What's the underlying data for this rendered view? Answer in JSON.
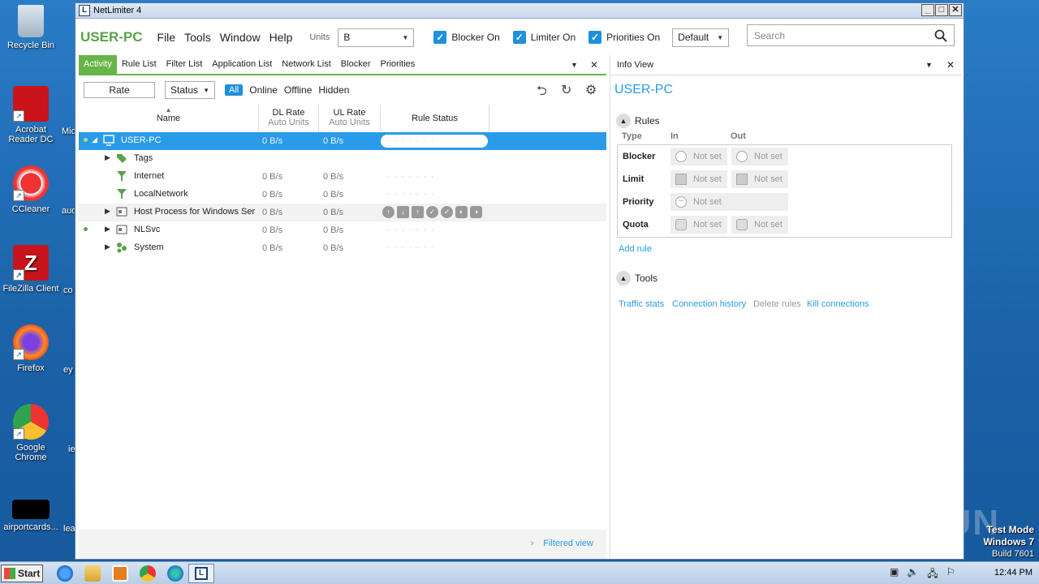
{
  "desktop": {
    "icons": [
      {
        "label": "Recycle Bin"
      },
      {
        "label": "Acrobat Reader DC"
      },
      {
        "label": "CCleaner"
      },
      {
        "label": "FileZilla Client"
      },
      {
        "label": "Firefox"
      },
      {
        "label": "Google Chrome"
      },
      {
        "label": "airportcards..."
      }
    ],
    "partial_labels": [
      "Mic",
      "aud",
      "co",
      "ey",
      "ie",
      "lea"
    ],
    "watermark": "ANY RUN",
    "testmode": {
      "line1": "Test Mode",
      "line2": "Windows 7",
      "line3": "Build 7601"
    }
  },
  "window": {
    "title": "NetLimiter 4",
    "brand": "USER-PC",
    "menu": [
      "File",
      "Tools",
      "Window",
      "Help"
    ],
    "units_label": "Units",
    "units_value": "B",
    "checkboxes": [
      {
        "label": "Blocker On",
        "checked": true
      },
      {
        "label": "Limiter On",
        "checked": true
      },
      {
        "label": "Priorities On",
        "checked": true
      }
    ],
    "profile": "Default",
    "search_placeholder": "Search"
  },
  "left": {
    "tabs": [
      "Activity",
      "Rule List",
      "Filter List",
      "Application List",
      "Network List",
      "Blocker",
      "Priorities"
    ],
    "rate_box": "Rate",
    "status_select": "Status",
    "filters": {
      "all": "All",
      "online": "Online",
      "offline": "Offline",
      "hidden": "Hidden"
    },
    "columns": {
      "name": "Name",
      "dl": "DL Rate",
      "dl_sub": "Auto Units",
      "ul": "UL Rate",
      "ul_sub": "Auto Units",
      "rule_status": "Rule Status"
    },
    "rows": [
      {
        "name": "USER-PC",
        "dl": "0 B/s",
        "ul": "0 B/s"
      },
      {
        "name": "Tags",
        "dl": "",
        "ul": ""
      },
      {
        "name": "Internet",
        "dl": "0 B/s",
        "ul": "0 B/s"
      },
      {
        "name": "LocalNetwork",
        "dl": "0 B/s",
        "ul": "0 B/s"
      },
      {
        "name": "Host Process for Windows Ser",
        "dl": "0 B/s",
        "ul": "0 B/s"
      },
      {
        "name": "NLSvc",
        "dl": "0 B/s",
        "ul": "0 B/s"
      },
      {
        "name": "System",
        "dl": "0 B/s",
        "ul": "0 B/s"
      }
    ],
    "footer_link": "Filtered view"
  },
  "info": {
    "header": "Info View",
    "title": "USER-PC",
    "rules_section": "Rules",
    "col_type": "Type",
    "col_in": "In",
    "col_out": "Out",
    "rules": [
      {
        "type": "Blocker",
        "in": "Not set",
        "out": "Not set"
      },
      {
        "type": "Limit",
        "in": "Not set",
        "out": "Not set"
      },
      {
        "type": "Priority",
        "in": "Not set",
        "out": ""
      },
      {
        "type": "Quota",
        "in": "Not set",
        "out": "Not set"
      }
    ],
    "add_rule": "Add rule",
    "tools_section": "Tools",
    "tools_links": [
      "Traffic stats",
      "Connection history",
      "Delete rules",
      "Kill connections"
    ]
  },
  "taskbar": {
    "start": "Start",
    "clock": "12:44 PM"
  },
  "colors": {
    "accent_green": "#67b548",
    "accent_blue": "#2a9be8"
  }
}
